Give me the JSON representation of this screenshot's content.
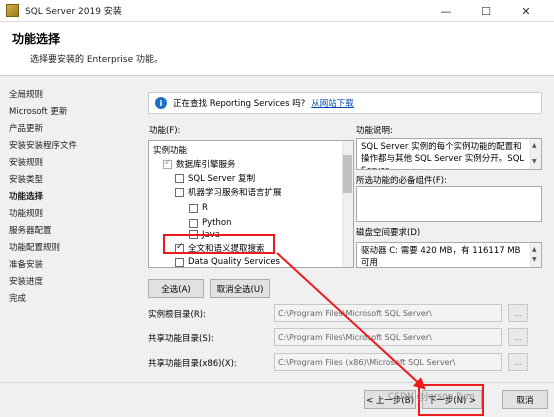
{
  "window": {
    "title": "SQL Server 2019 安装",
    "minimize": "—",
    "maximize": "☐",
    "close": "✕"
  },
  "header": {
    "title": "功能选择",
    "subtitle": "选择要安装的 Enterprise 功能。"
  },
  "sidebar": {
    "items": [
      "全局规则",
      "Microsoft 更新",
      "产品更新",
      "安装安装程序文件",
      "安装规则",
      "安装类型",
      "功能选择",
      "功能规则",
      "服务器配置",
      "功能配置规则",
      "准备安装",
      "安装进度",
      "完成"
    ]
  },
  "info": {
    "text": "正在查找 Reporting Services 吗?",
    "link": "从网站下载"
  },
  "features": {
    "label": "功能(F):",
    "items": [
      {
        "label": "实例功能",
        "checkbox": false,
        "checked": false
      },
      {
        "label": "数据库引擎服务",
        "checkbox": true,
        "checked": true,
        "grey": true
      },
      {
        "label": "SQL Server 复制",
        "checkbox": true,
        "checked": false
      },
      {
        "label": "机器学习服务和语言扩展",
        "checkbox": true,
        "checked": false
      },
      {
        "label": "R",
        "checkbox": true,
        "checked": false
      },
      {
        "label": "Python",
        "checkbox": true,
        "checked": false
      },
      {
        "label": "Java",
        "checkbox": true,
        "checked": false
      },
      {
        "label": "全文和语义提取搜索",
        "checkbox": true,
        "checked": true
      },
      {
        "label": "Data Quality Services",
        "checkbox": true,
        "checked": false
      }
    ]
  },
  "description": {
    "label": "功能说明:",
    "text": "SQL Server 实例的每个实例功能的配置和操作都与其他 SQL Server 实例分开。SQL Server",
    "prereq_label": "所选功能的必备组件(F):",
    "disk_label": "磁盘空间要求(D)",
    "disk_text": "驱动器 C: 需要 420 MB，有 116117 MB 可用"
  },
  "buttons": {
    "select_all": "全选(A)",
    "deselect_all": "取消全选(U)",
    "browse": "...",
    "back": "< 上一步(B)",
    "next": "下一步(N) >",
    "cancel": "取消"
  },
  "dirs": {
    "instance_label": "实例根目录(R):",
    "instance_value": "C:\\Program Files\\Microsoft SQL Server\\",
    "shared_label": "共享功能目录(S):",
    "shared_value": "C:\\Program Files\\Microsoft SQL Server\\",
    "shared86_label": "共享功能目录(x86)(X):",
    "shared86_value": "C:\\Program Files (x86)\\Microsoft SQL Server\\"
  },
  "watermark": "CSDN @Jerson Fym",
  "colors": {
    "annotation": "#ea1c1c",
    "link": "#0645ad",
    "info_icon": "#1f6fc9"
  }
}
